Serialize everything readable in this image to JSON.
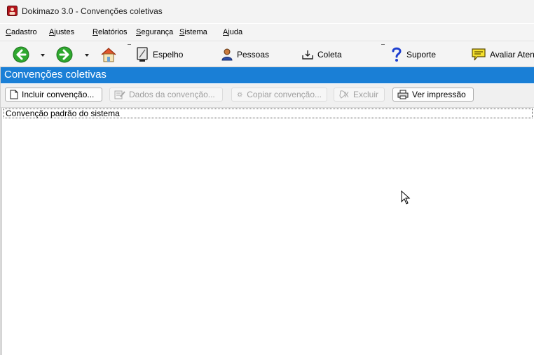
{
  "window": {
    "title": "Dokimazo 3.0 - Convenções coletivas"
  },
  "menu": [
    "Cadastro",
    "Ajustes",
    "Relatórios",
    "Segurança",
    "Sistema",
    "Ajuda"
  ],
  "toolbar": {
    "espelho": "Espelho",
    "pessoas": "Pessoas",
    "coleta": "Coleta",
    "suporte": "Suporte",
    "avaliar": "Avaliar Aten"
  },
  "section": {
    "title": "Convenções coletivas"
  },
  "actions": {
    "incluir": "Incluir convenção...",
    "dados": "Dados da convenção...",
    "copiar": "Copiar convenção...",
    "excluir": "Excluir",
    "ver": "Ver impressão"
  },
  "list": {
    "items": [
      "Convenção padrão do sistema"
    ]
  },
  "colors": {
    "header_blue": "#1a7fd6",
    "nav_green": "#2fa82f",
    "help_blue": "#1e3fd0"
  }
}
